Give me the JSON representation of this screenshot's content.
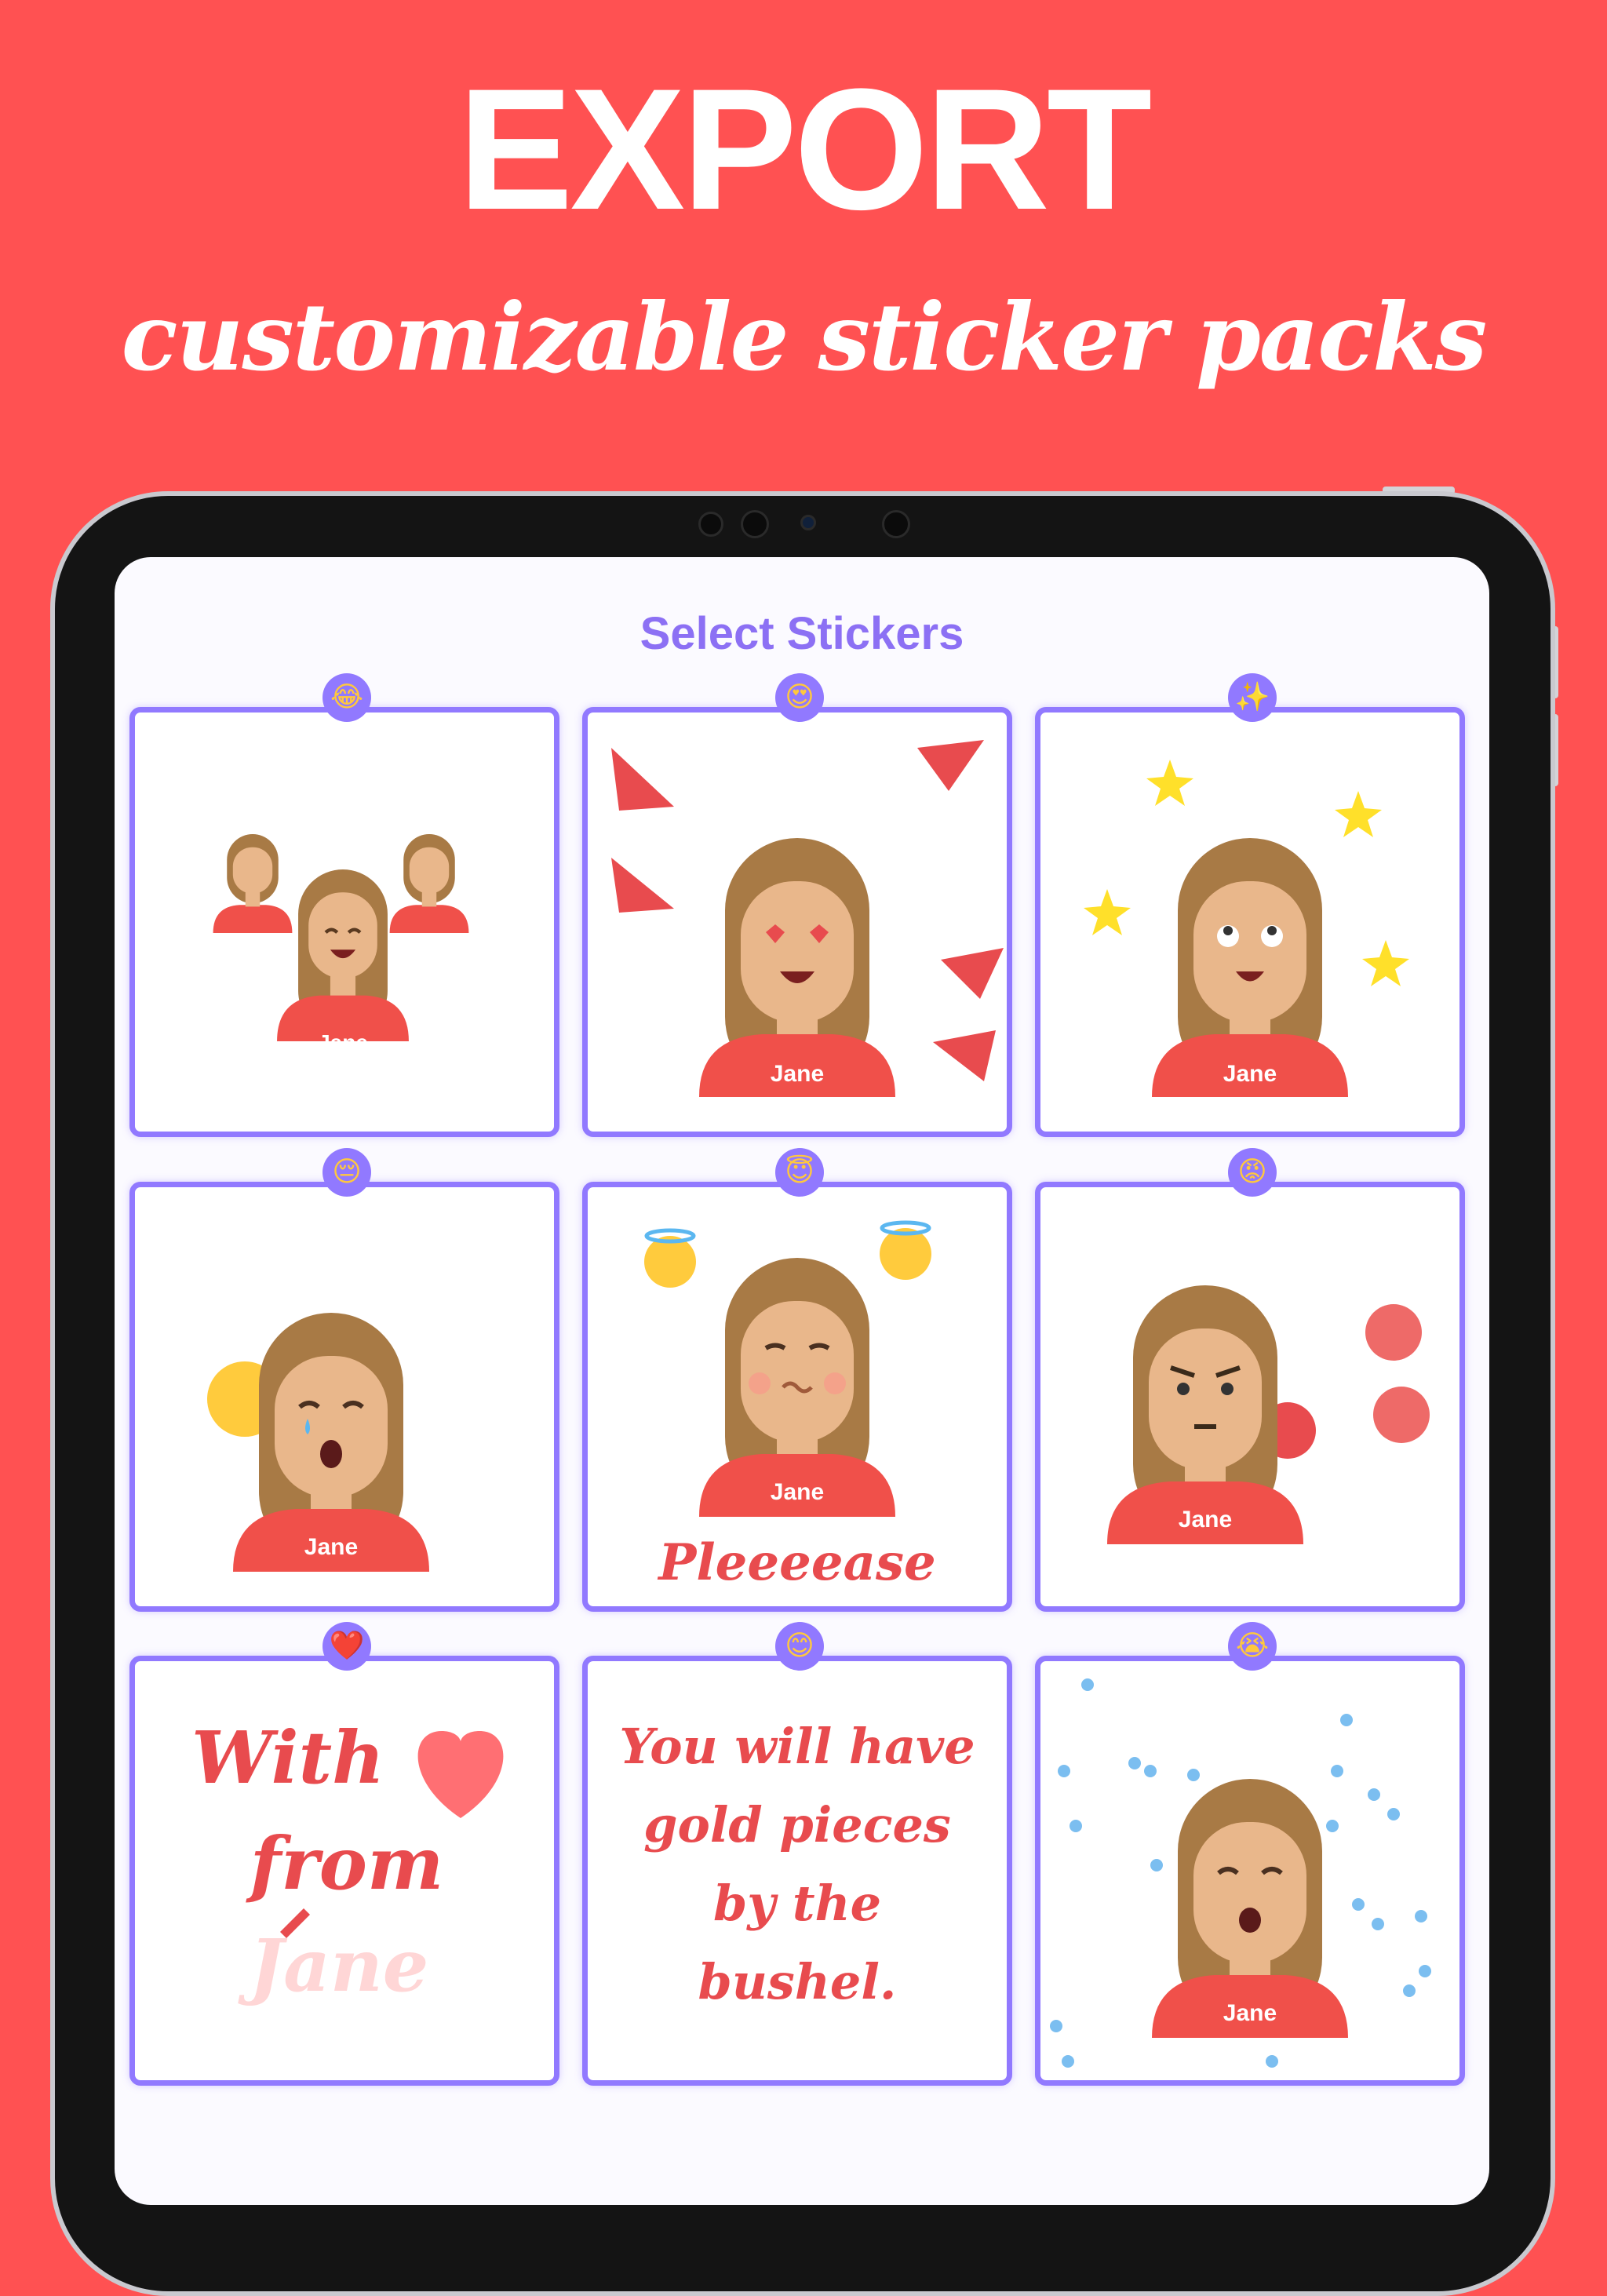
{
  "header": {
    "title": "EXPORT",
    "subtitle": "customizable sticker packs"
  },
  "screen": {
    "title": "Select Stickers"
  },
  "colors": {
    "background": "#FF5152",
    "accent": "#9179FF",
    "shirt": "#F0504A",
    "hair": "#A87A45",
    "skin": "#E9B78B"
  },
  "stickers": [
    {
      "emoji": "😂",
      "name": "Jane",
      "icon": "laughing-face-icon"
    },
    {
      "emoji": "😍",
      "name": "Jane",
      "icon": "heart-eyes-icon"
    },
    {
      "emoji": "✨",
      "name": "Jane",
      "icon": "sparkles-icon"
    },
    {
      "emoji": "😔",
      "name": "Jane",
      "icon": "pensive-face-icon"
    },
    {
      "emoji": "😇",
      "name": "Jane",
      "caption": "Pleeeease",
      "icon": "halo-face-icon"
    },
    {
      "emoji": "😡",
      "name": "Jane",
      "icon": "angry-face-icon"
    },
    {
      "emoji": "❤️",
      "lines": [
        "With",
        "from",
        "Jane"
      ],
      "icon": "heart-icon"
    },
    {
      "emoji": "😊",
      "lines": [
        "You will have",
        "gold pieces",
        "by the",
        "bushel."
      ],
      "icon": "smiling-face-icon"
    },
    {
      "emoji": "😭",
      "name": "Jane",
      "icon": "crying-face-icon"
    }
  ]
}
